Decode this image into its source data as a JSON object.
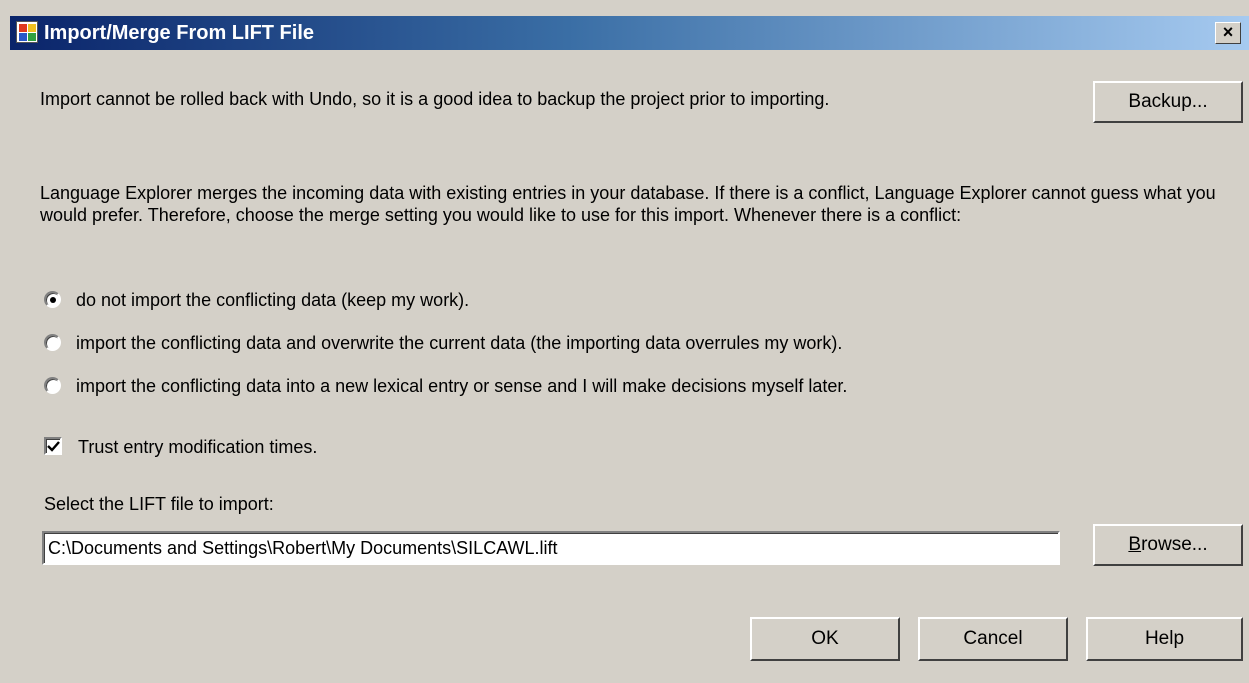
{
  "window": {
    "title": "Import/Merge From LIFT File",
    "close_label": "×"
  },
  "backup": {
    "message": "Import cannot be rolled back with Undo, so it is a good idea to backup the project prior to importing.",
    "button_label": "Backup..."
  },
  "merge": {
    "description": "Language Explorer merges the incoming data with existing entries in your database.  If there is a conflict, Language Explorer cannot guess what you would prefer.  Therefore, choose the merge setting you would like to use for this import.  Whenever there is a conflict:",
    "options": [
      {
        "label": "do not import the conflicting data (keep my work).",
        "selected": true
      },
      {
        "label": "import the conflicting data and overwrite the current data (the importing data overrules my work).",
        "selected": false
      },
      {
        "label": "import the conflicting data into a new lexical entry or sense and I will make decisions myself later.",
        "selected": false
      }
    ]
  },
  "trust": {
    "label": "Trust entry modification times.",
    "checked": true
  },
  "file": {
    "label": "Select the LIFT file to import:",
    "value": "C:\\Documents and Settings\\Robert\\My Documents\\SILCAWL.lift",
    "browse_label": "Browse..."
  },
  "footer": {
    "ok_label": "OK",
    "cancel_label": "Cancel",
    "help_label": "Help"
  },
  "colors": {
    "face": "#d4d0c8",
    "title_start": "#0a246a",
    "title_end": "#a6caf0"
  }
}
